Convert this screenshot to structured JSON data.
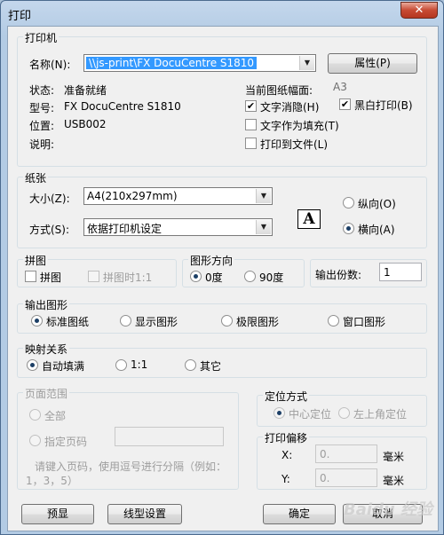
{
  "window": {
    "title": "打印",
    "close_glyph": "✕"
  },
  "printer": {
    "group_label": "打印机",
    "name_label": "名称(N):",
    "name_value": "\\\\js-print\\FX DocuCentre S1810",
    "properties_button": "属性(P)",
    "status_label": "状态:",
    "status_value": "准备就绪",
    "model_label": "型号:",
    "model_value": "FX DocuCentre S1810",
    "location_label": "位置:",
    "location_value": "USB002",
    "comment_label": "说明:",
    "paper_width_label": "当前图纸幅面:",
    "paper_width_value": "A3",
    "text_antialias": "文字消隐(H)",
    "text_as_fill": "文字作为填充(T)",
    "print_to_file": "打印到文件(L)",
    "black_white": "黑白打印(B)"
  },
  "paper": {
    "group_label": "纸张",
    "size_label": "大小(Z):",
    "size_value": "A4(210x297mm)",
    "mode_label": "方式(S):",
    "mode_value": "依据打印机设定",
    "orientation_glyph": "A",
    "portrait": "纵向(O)",
    "landscape": "横向(A)"
  },
  "tile": {
    "group_label": "拼图",
    "tile": "拼图",
    "tile_1_1": "拼图时1:1"
  },
  "rotation": {
    "group_label": "图形方向",
    "deg0": "0度",
    "deg90": "90度"
  },
  "copies": {
    "label": "输出份数:",
    "value": "1"
  },
  "output": {
    "group_label": "输出图形",
    "options": [
      "标准图纸",
      "显示图形",
      "极限图形",
      "窗口图形"
    ]
  },
  "mapping": {
    "group_label": "映射关系",
    "options": [
      "自动填满",
      "1:1",
      "其它"
    ]
  },
  "page_range": {
    "group_label": "页面范围",
    "all": "全部",
    "specified": "指定页码",
    "hint": "请键入页码，使用逗号进行分隔（例如：1，3，5）"
  },
  "position": {
    "group_label": "定位方式",
    "center": "中心定位",
    "top_left": "左上角定位"
  },
  "offset": {
    "group_label": "打印偏移",
    "x_label": "X:",
    "x_value": "0.",
    "x_unit": "毫米",
    "y_label": "Y:",
    "y_value": "0.",
    "y_unit": "毫米"
  },
  "buttons": {
    "preview": "预显",
    "line_settings": "线型设置",
    "ok": "确定",
    "cancel": "取消"
  },
  "watermark": {
    "text": "Baidu 经验"
  }
}
